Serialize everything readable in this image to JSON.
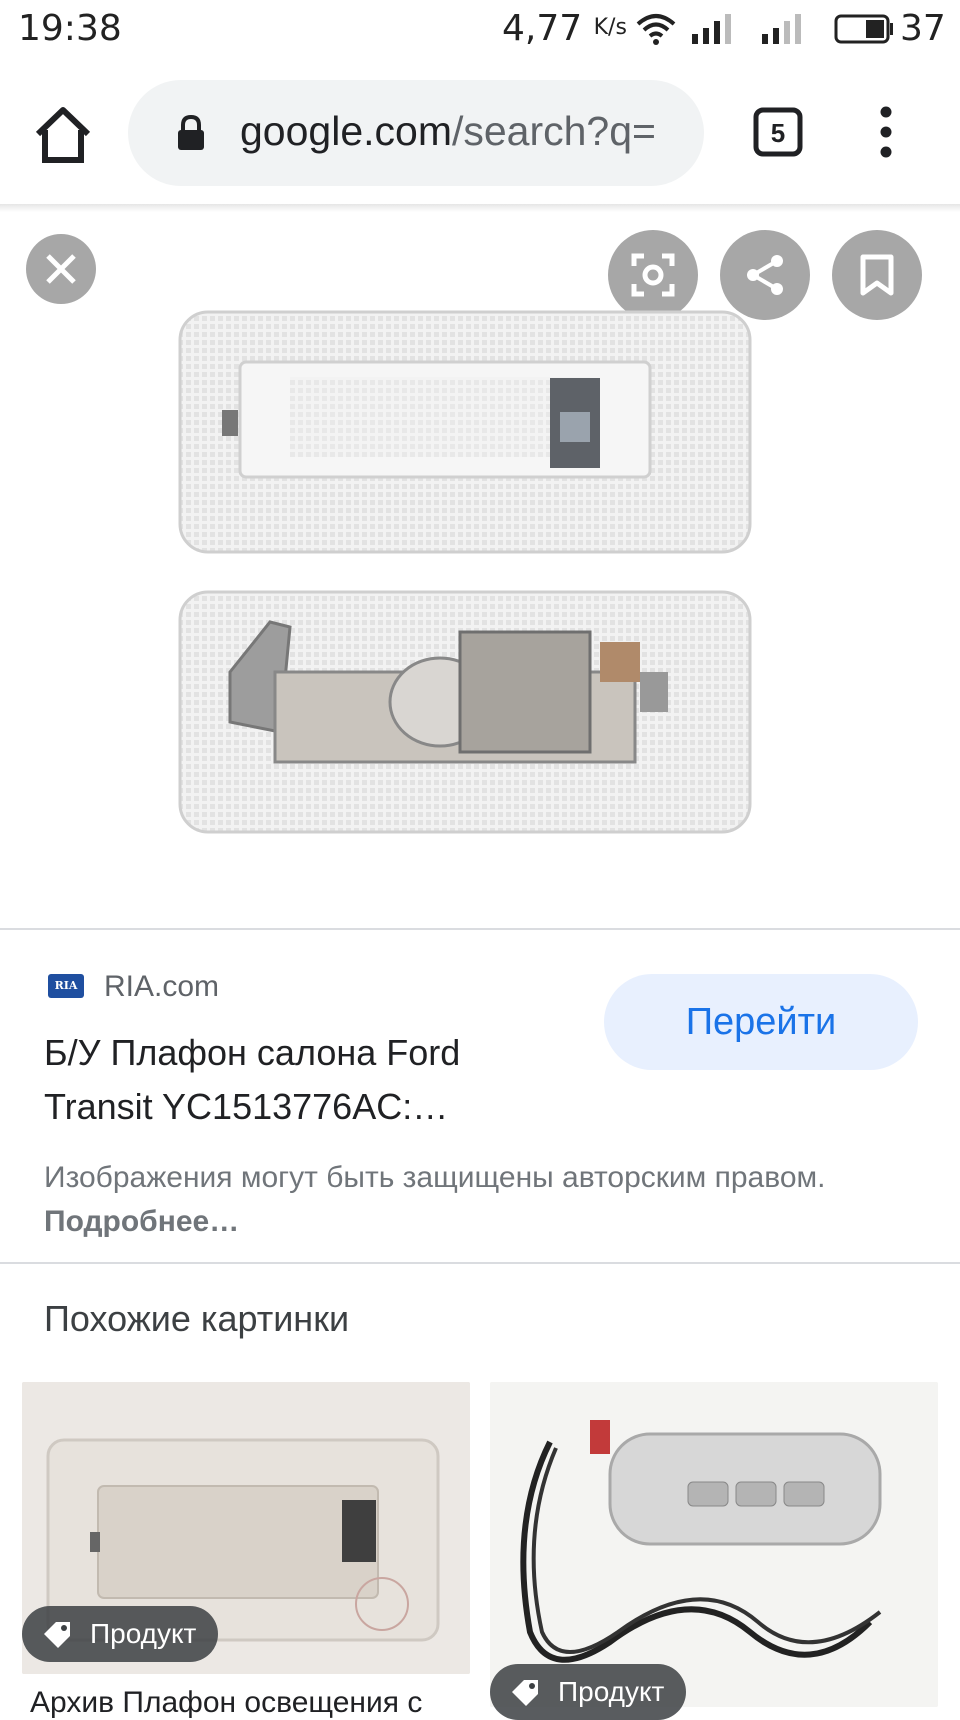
{
  "status_bar": {
    "time": "19:38",
    "net_speed": "4,77",
    "net_speed_unit": "K/s",
    "battery_level": "37"
  },
  "browser": {
    "url_host": "google.com",
    "url_path": "/search?q=",
    "tab_count": "5"
  },
  "result": {
    "source_name": "RIA.com",
    "source_logo_text": "RIA",
    "visit_label": "Перейти",
    "title": "Б/У Плафон салона Ford Transit YC1513776AC:…",
    "copyright_text": "Изображения могут быть защищены авторским правом.",
    "copyright_more": "Подробнее…"
  },
  "related": {
    "heading": "Похожие картинки",
    "items": [
      {
        "chip_label": "Продукт",
        "caption": "Архив Плафон освещения с"
      },
      {
        "chip_label": "Продукт"
      }
    ]
  },
  "colors": {
    "link_blue": "#1a73e8",
    "visit_bg": "#e8f0fe",
    "overlay_btn": "#787878"
  },
  "icons": [
    "home-icon",
    "lock-icon",
    "tab-switcher-icon",
    "more-vert-icon",
    "close-icon",
    "lens-icon",
    "share-icon",
    "bookmark-icon",
    "tag-icon"
  ]
}
